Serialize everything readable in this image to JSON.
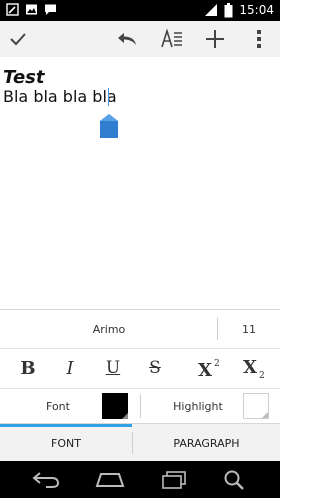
{
  "status": {
    "time": "15:04"
  },
  "toolbar": {
    "icons": [
      "check-icon",
      "undo-icon",
      "text-format-icon",
      "add-icon",
      "overflow-menu-icon"
    ]
  },
  "document": {
    "title": "Test",
    "body": "Bla bla bla bla"
  },
  "format_panel": {
    "font_name": "Arimo",
    "font_size": "11",
    "buttons": {
      "bold": "B",
      "italic": "I",
      "underline": "U",
      "strike": "S"
    },
    "font_color_label": "Font",
    "highlight_label": "Highlight"
  },
  "tabs": {
    "font": "FONT",
    "paragraph": "PARAGRAPH"
  },
  "colors": {
    "accent": "#33a2e5",
    "font_color": "#000000",
    "highlight_color": "#ffffff"
  }
}
